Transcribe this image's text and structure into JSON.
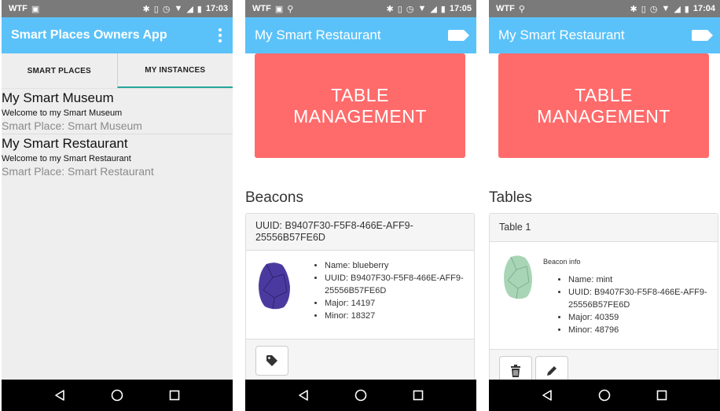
{
  "screens": [
    {
      "status": {
        "carrier": "WTF",
        "time": "17:03"
      },
      "appbar": {
        "title": "Smart Places Owners App"
      },
      "tabs": [
        {
          "label": "SMART PLACES"
        },
        {
          "label": "MY INSTANCES"
        }
      ],
      "places": [
        {
          "title": "My Smart Museum",
          "welcome": "Welcome to my Smart Museum",
          "smart_place": "Smart Place:  Smart Museum"
        },
        {
          "title": "My Smart Restaurant",
          "welcome": "Welcome to my Smart Restaurant",
          "smart_place": "Smart Place:  Smart Restaurant"
        }
      ]
    },
    {
      "status": {
        "carrier": "WTF",
        "time": "17:05"
      },
      "appbar": {
        "title": "My Smart Restaurant"
      },
      "table_button": {
        "line1": "TABLE",
        "line2": "MANAGEMENT"
      },
      "section_title": "Beacons",
      "card": {
        "header": "UUID: B9407F30-F5F8-466E-AFF9-25556B57FE6D",
        "details": [
          "Name: blueberry",
          "UUID: B9407F30-F5F8-466E-AFF9-25556B57FE6D",
          "Major: 14197",
          "Minor: 18327"
        ],
        "beacon_color": "#4a3aa0"
      }
    },
    {
      "status": {
        "carrier": "WTF",
        "time": "17:04"
      },
      "appbar": {
        "title": "My Smart Restaurant"
      },
      "table_button": {
        "line1": "TABLE",
        "line2": "MANAGEMENT"
      },
      "section_title": "Tables",
      "card": {
        "header": "Table 1",
        "info_label": "Beacon info",
        "details": [
          "Name: mint",
          "UUID: B9407F30-F5F8-466E-AFF9-25556B57FE6D",
          "Major: 40359",
          "Minor: 48796"
        ],
        "beacon_color": "#a8d5b5"
      }
    }
  ],
  "colors": {
    "appbar": "#5bc2f9",
    "statusbar": "#7a7a7a",
    "accent": "#ff6b6b",
    "tab_indicator": "#26a69a"
  },
  "icons": {
    "back": "back-icon",
    "home": "home-icon",
    "recents": "recents-icon",
    "tag": "tag-icon",
    "delete": "trash-icon",
    "edit": "pencil-icon"
  }
}
